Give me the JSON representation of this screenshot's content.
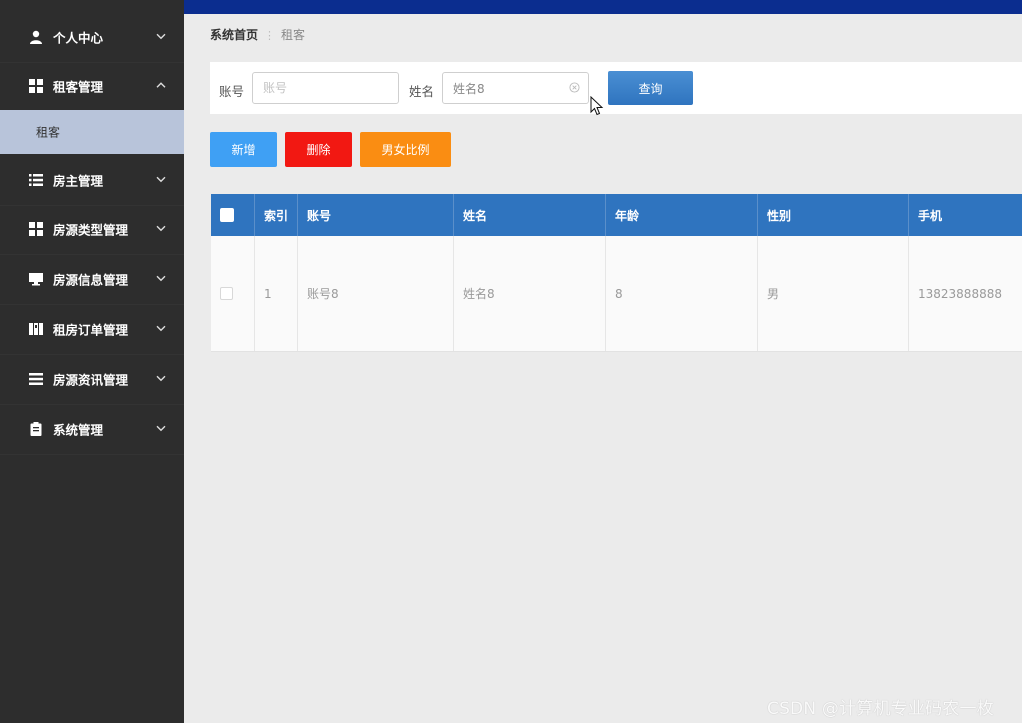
{
  "sidebar": {
    "items": [
      {
        "label": "个人中心",
        "icon": "user-icon"
      },
      {
        "label": "租客管理",
        "icon": "grid-icon",
        "expanded": true
      },
      {
        "label": "房主管理",
        "icon": "list-icon"
      },
      {
        "label": "房源类型管理",
        "icon": "grid-icon"
      },
      {
        "label": "房源信息管理",
        "icon": "monitor-icon"
      },
      {
        "label": "租房订单管理",
        "icon": "book-icon"
      },
      {
        "label": "房源资讯管理",
        "icon": "list-icon"
      },
      {
        "label": "系统管理",
        "icon": "clipboard-icon"
      }
    ],
    "submenu": {
      "label": "租客"
    }
  },
  "breadcrumb": {
    "home": "系统首页",
    "separator": "⋮",
    "current": "租客"
  },
  "search": {
    "account_label": "账号",
    "account_placeholder": "账号",
    "name_label": "姓名",
    "name_value": "姓名8",
    "search_button": "查询"
  },
  "actions": {
    "add": "新增",
    "delete": "删除",
    "ratio": "男女比例"
  },
  "table": {
    "columns": [
      "索引",
      "账号",
      "姓名",
      "年龄",
      "性别",
      "手机"
    ],
    "rows": [
      {
        "index": "1",
        "account": "账号8",
        "name": "姓名8",
        "age": "8",
        "gender": "男",
        "phone": "13823888888"
      }
    ]
  },
  "colors": {
    "sidebar": "#2d2d2d",
    "topbar": "#0b2d8f",
    "table_header": "#2f74bf",
    "add": "#3fa0f4",
    "delete": "#f21812",
    "ratio": "#fa8d12"
  },
  "watermark": "CSDN @计算机专业码农一枚"
}
